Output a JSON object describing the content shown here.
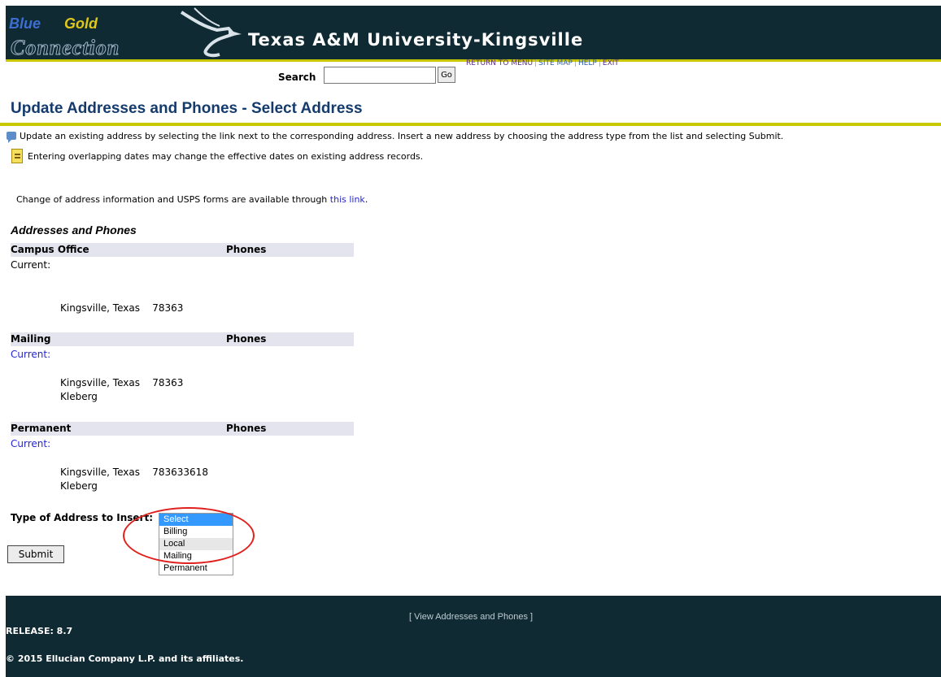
{
  "header": {
    "logo_line1_blue": "Blue",
    "logo_line1_gold": "Gold",
    "logo_line2": "Connection",
    "university": "Texas A&M University-Kingsville"
  },
  "search": {
    "label": "Search",
    "value": "",
    "go_label": "Go"
  },
  "nav": {
    "return": "RETURN TO MENU",
    "site_map": "SITE MAP",
    "help": "HELP",
    "exit": "EXIT",
    "separator": "|"
  },
  "page": {
    "title": "Update Addresses and Phones - Select Address",
    "info": "Update an existing address by selecting the link next to the corresponding address. Insert a new address by choosing the address type from the list and selecting Submit.",
    "note": "Entering overlapping dates may change the effective dates on existing address records.",
    "change_prefix": "Change of address information and USPS forms are available through ",
    "change_link": "this link",
    "change_suffix": ".",
    "section": "Addresses and Phones"
  },
  "addresses": [
    {
      "type": "Campus Office",
      "phones": "Phones",
      "current": "Current:",
      "city": "Kingsville, Texas",
      "zip": "78363",
      "county": ""
    },
    {
      "type": "Mailing",
      "phones": "Phones",
      "current": "Current:",
      "city": "Kingsville, Texas",
      "zip": "78363",
      "county": "Kleberg"
    },
    {
      "type": "Permanent",
      "phones": "Phones",
      "current": "Current:",
      "city": "Kingsville, Texas",
      "zip": "783633618",
      "county": "Kleberg"
    }
  ],
  "insert": {
    "label": "Type of Address to Insert:",
    "options": [
      "Select",
      "Billing",
      "Local",
      "Mailing",
      "Permanent"
    ],
    "selected": "Select"
  },
  "submit_label": "Submit",
  "footer": {
    "link_prefix": "[ ",
    "link": "View Addresses and Phones",
    "link_suffix": " ]",
    "release": "RELEASE: 8.7",
    "copyright": "© 2015 Ellucian Company L.P. and its affiliates."
  },
  "colors": {
    "header_bg": "#0f2a33",
    "accent_rule": "#c9c800",
    "title": "#153b6d",
    "link": "#2424d6",
    "highlight_circle": "#e0201c"
  }
}
